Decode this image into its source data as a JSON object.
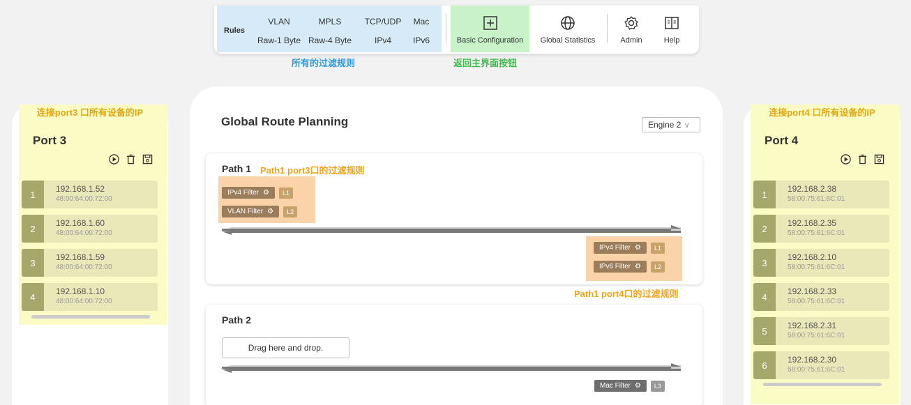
{
  "toolbar": {
    "rules_title": "Rules",
    "rules": [
      "VLAN",
      "MPLS",
      "TCP/UDP",
      "Mac",
      "Raw-1 Byte",
      "Raw-4 Byte",
      "IPv4",
      "IPv6"
    ],
    "basic_config": "Basic Configuration",
    "global_stats": "Global Statistics",
    "admin": "Admin",
    "help": "Help"
  },
  "annotations": {
    "all_rules": "所有的过滤规则",
    "return_main": "返回主界面按钮",
    "left_panel": "连接port3 口所有设备的IP",
    "right_panel": "连接port4 口所有设备的IP",
    "path1_port3": "Path1 port3口的过滤规则",
    "path1_port4": "Path1 port4口的过滤规则"
  },
  "left": {
    "title": "Port 3",
    "devices": [
      {
        "num": "1",
        "ip": "192.168.1.52",
        "mac": "48:00:64:00:72:00"
      },
      {
        "num": "2",
        "ip": "192.168.1.60",
        "mac": "48:00:64:00:72:00"
      },
      {
        "num": "3",
        "ip": "192.168.1.59",
        "mac": "48:00:64:00:72:00"
      },
      {
        "num": "4",
        "ip": "192.168.1.10",
        "mac": "48:00:64:00:72:00"
      }
    ]
  },
  "right": {
    "title": "Port 4",
    "devices": [
      {
        "num": "1",
        "ip": "192.168.2.38",
        "mac": "58:00:75:61:6C:01"
      },
      {
        "num": "2",
        "ip": "192.168.2.35",
        "mac": "58:00:75:61:6C:01"
      },
      {
        "num": "3",
        "ip": "192.168.2.10",
        "mac": "58:00:75:61:6C:01"
      },
      {
        "num": "4",
        "ip": "192.168.2.33",
        "mac": "58:00:75:61:6C:01"
      },
      {
        "num": "5",
        "ip": "192.168.2.31",
        "mac": "58:00:75:61:6C:01"
      },
      {
        "num": "6",
        "ip": "192.168.2.30",
        "mac": "58:00:75:61:6C:01"
      }
    ]
  },
  "main": {
    "title": "Global Route Planning",
    "engine": "Engine 2",
    "path1": {
      "title": "Path 1",
      "left_filters": [
        {
          "name": "IPv4 Filter",
          "tag": "L1"
        },
        {
          "name": "VLAN Filter",
          "tag": "L2"
        }
      ],
      "right_filters": [
        {
          "name": "IPv4 Filter",
          "tag": "L1"
        },
        {
          "name": "IPv6 Filter",
          "tag": "L2"
        }
      ]
    },
    "path2": {
      "title": "Path 2",
      "drop": "Drag here and drop.",
      "right_filters": [
        {
          "name": "Mac Filter",
          "tag": "L3"
        }
      ]
    }
  },
  "colors": {
    "rules_bg": "#d6ebf7",
    "basic_bg": "#c8f2c8",
    "panel_bg": "#fbfbc6",
    "filter_bg": "#fbd3a8"
  }
}
